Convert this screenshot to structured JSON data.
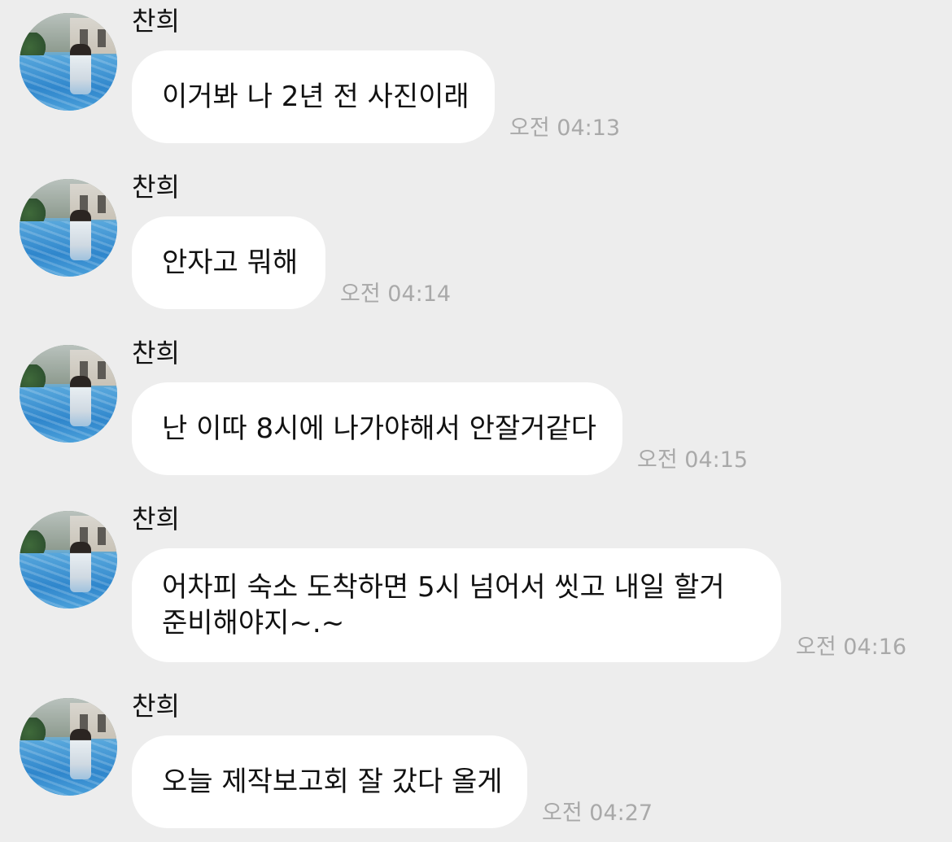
{
  "messages": [
    {
      "sender": "찬희",
      "text": "이거봐 나 2년 전 사진이래",
      "time": "오전 04:13"
    },
    {
      "sender": "찬희",
      "text": "안자고 뭐해",
      "time": "오전 04:14"
    },
    {
      "sender": "찬희",
      "text": "난 이따 8시에 나가야해서 안잘거같다",
      "time": "오전 04:15"
    },
    {
      "sender": "찬희",
      "text": "어차피 숙소 도착하면 5시 넘어서 씻고 내일 할거 준비해야지~.~",
      "time": "오전 04:16"
    },
    {
      "sender": "찬희",
      "text": "오늘 제작보고회 잘 갔다 올게",
      "time": "오전 04:27"
    }
  ],
  "colors": {
    "background": "#ededed",
    "bubble": "#ffffff",
    "text": "#111111",
    "timestamp": "#a9a9a9"
  }
}
